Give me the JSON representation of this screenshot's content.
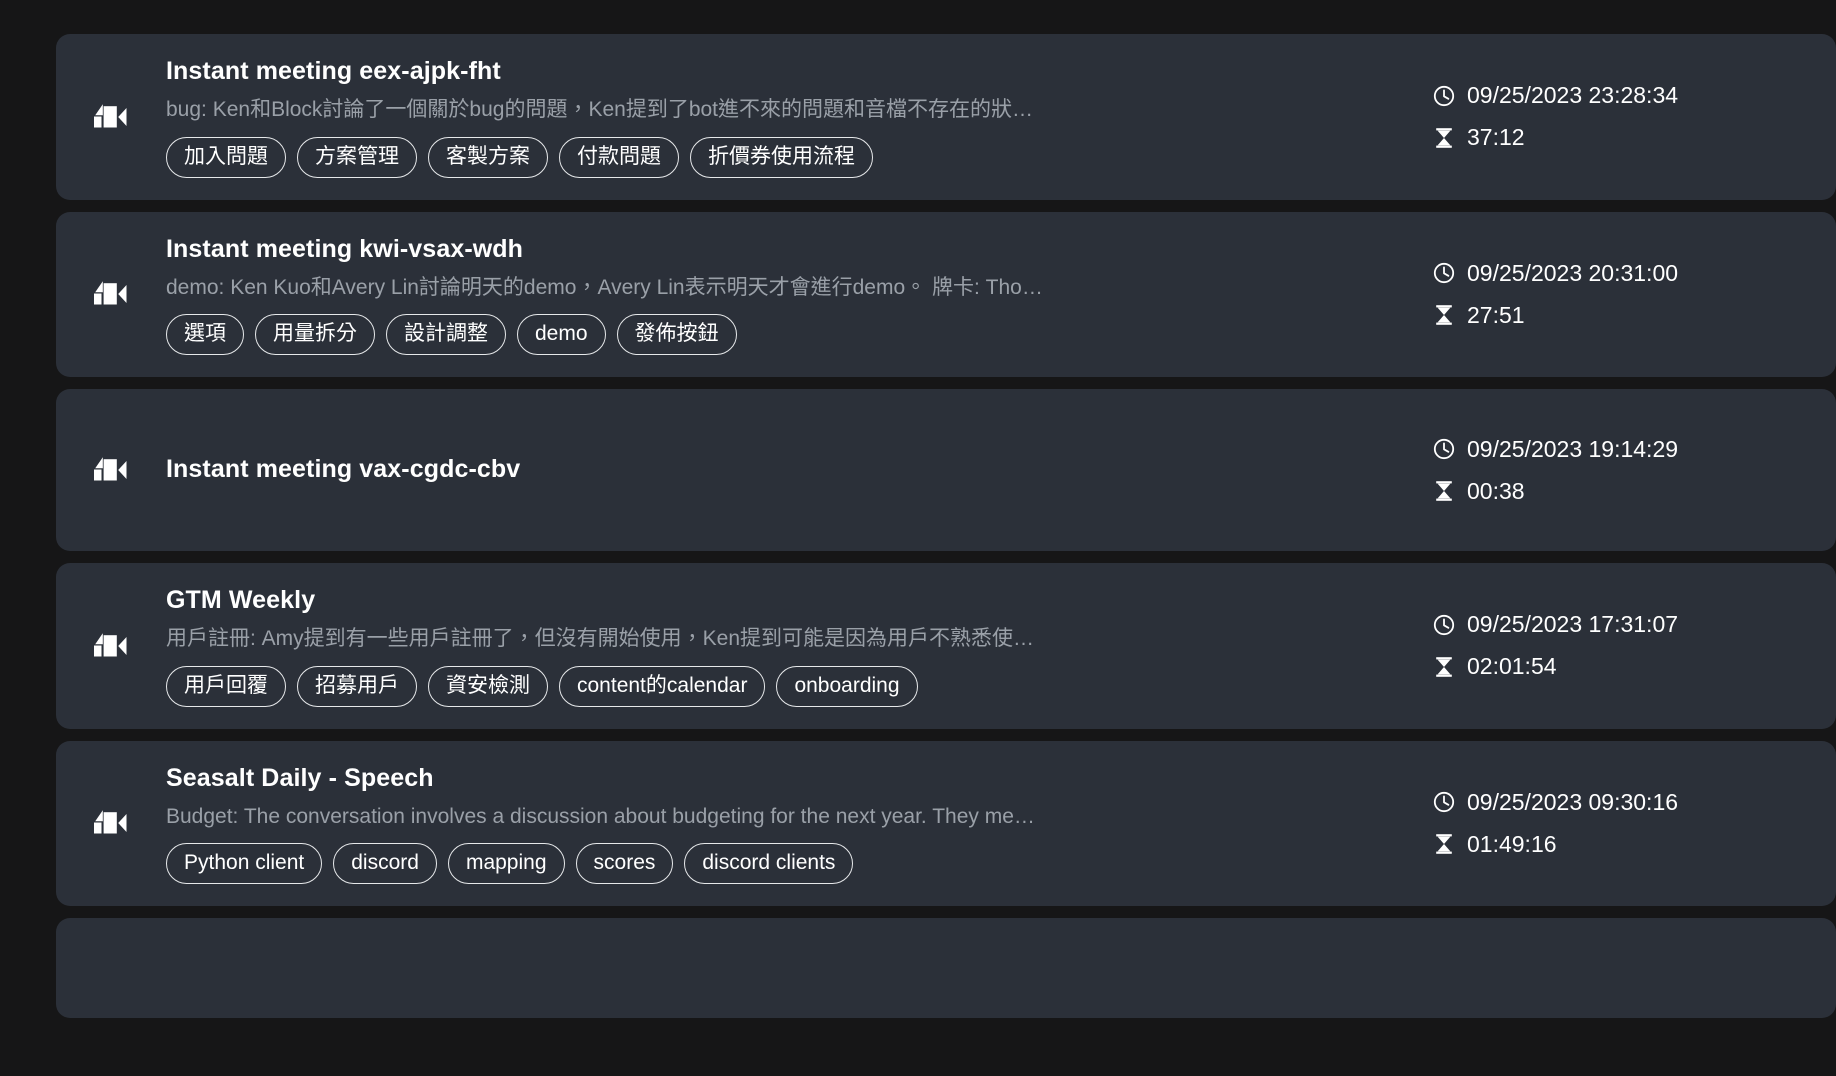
{
  "theme": {
    "page_background": "#161617",
    "card_background": "#2b3039",
    "title_color": "#ffffff",
    "summary_color": "#9aa0a8",
    "tag_border_color": "#e6e8ea",
    "meta_color": "#ffffff"
  },
  "icons": {
    "meeting": "video-camera-icon",
    "time": "clock-icon",
    "duration": "hourglass-icon"
  },
  "meetings": [
    {
      "title": "Instant meeting eex-ajpk-fht",
      "summary": "bug: Ken和Block討論了一個關於bug的問題，Ken提到了bot進不來的問題和音檔不存在的狀…",
      "tags": [
        "加入問題",
        "方案管理",
        "客製方案",
        "付款問題",
        "折價券使用流程"
      ],
      "timestamp": "09/25/2023 23:28:34",
      "duration": "37:12"
    },
    {
      "title": "Instant meeting kwi-vsax-wdh",
      "summary": "demo: Ken Kuo和Avery Lin討論明天的demo，Avery Lin表示明天才會進行demo。 牌卡: Tho…",
      "tags": [
        "選項",
        "用量拆分",
        "設計調整",
        "demo",
        "發佈按鈕"
      ],
      "timestamp": "09/25/2023 20:31:00",
      "duration": "27:51"
    },
    {
      "title": "Instant meeting vax-cgdc-cbv",
      "summary": "",
      "tags": [],
      "timestamp": "09/25/2023 19:14:29",
      "duration": "00:38"
    },
    {
      "title": "GTM Weekly",
      "summary": "用戶註冊: Amy提到有一些用戶註冊了，但沒有開始使用，Ken提到可能是因為用戶不熟悉使…",
      "tags": [
        "用戶回覆",
        "招募用戶",
        "資安檢測",
        "content的calendar",
        "onboarding"
      ],
      "timestamp": "09/25/2023 17:31:07",
      "duration": "02:01:54"
    },
    {
      "title": "Seasalt Daily - Speech",
      "summary": "Budget: The conversation involves a discussion about budgeting for the next year. They me…",
      "tags": [
        "Python client",
        "discord",
        "mapping",
        "scores",
        "discord clients"
      ],
      "timestamp": "09/25/2023 09:30:16",
      "duration": "01:49:16"
    },
    {
      "title": "",
      "summary": "",
      "tags": [],
      "timestamp": "",
      "duration": ""
    }
  ]
}
